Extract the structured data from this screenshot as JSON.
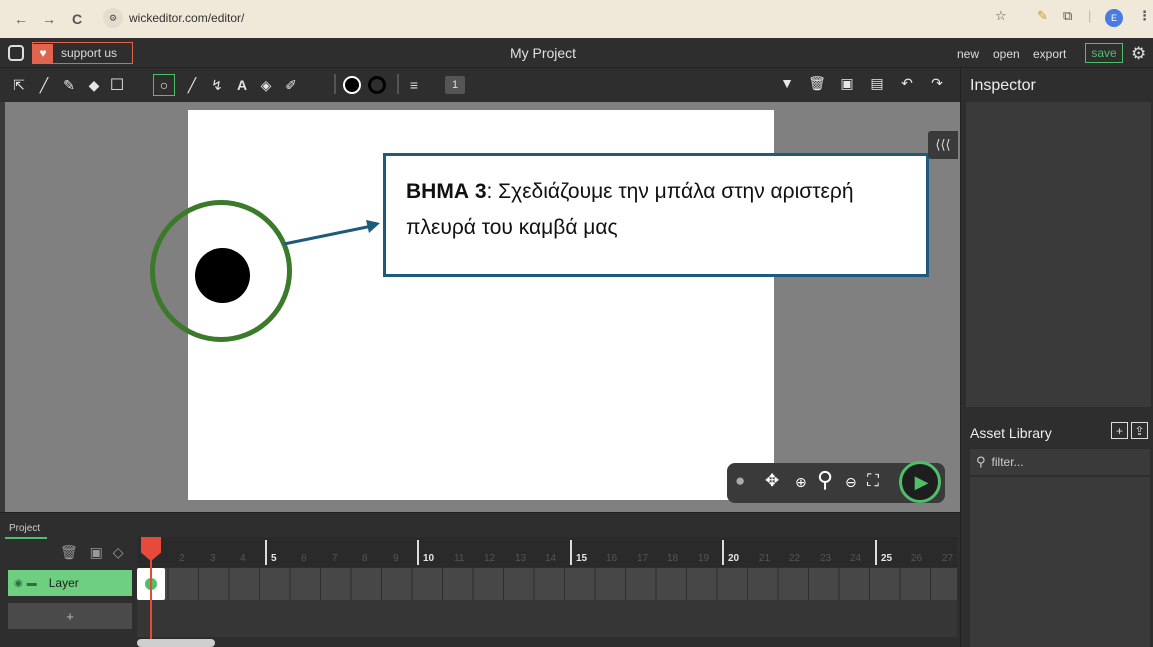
{
  "browser": {
    "url": "wickeditor.com/editor/",
    "back_icon": "←",
    "forward_icon": "→",
    "reload_icon": "C",
    "profile_initial": "E"
  },
  "header": {
    "support_label": "support us",
    "project_title": "My Project",
    "new_label": "new",
    "open_label": "open",
    "export_label": "export",
    "save_label": "save"
  },
  "toolbar": {
    "line_count": "1"
  },
  "callout": {
    "strong": "ΒΗΜΑ 3",
    "text": ": Σχεδιάζουμε την μπάλα στην αριστερή πλευρά του καμβά μας"
  },
  "inspector": {
    "title": "Inspector"
  },
  "asset_library": {
    "title": "Asset Library",
    "filter_placeholder": "filter..."
  },
  "timeline": {
    "tab_label": "Project",
    "layer_name": "Layer",
    "add_layer_label": "+",
    "frame_numbers": [
      "2",
      "3",
      "4",
      "5",
      "6",
      "7",
      "8",
      "9",
      "10",
      "11",
      "12",
      "13",
      "14",
      "15",
      "16",
      "17",
      "18",
      "19",
      "20",
      "21",
      "22",
      "23",
      "24",
      "25",
      "26",
      "27"
    ]
  },
  "colors": {
    "accent_green": "#4fbf6a",
    "support_red": "#e0644e",
    "callout_border": "#1d5a7c",
    "ring_green": "#3a7a2a"
  }
}
